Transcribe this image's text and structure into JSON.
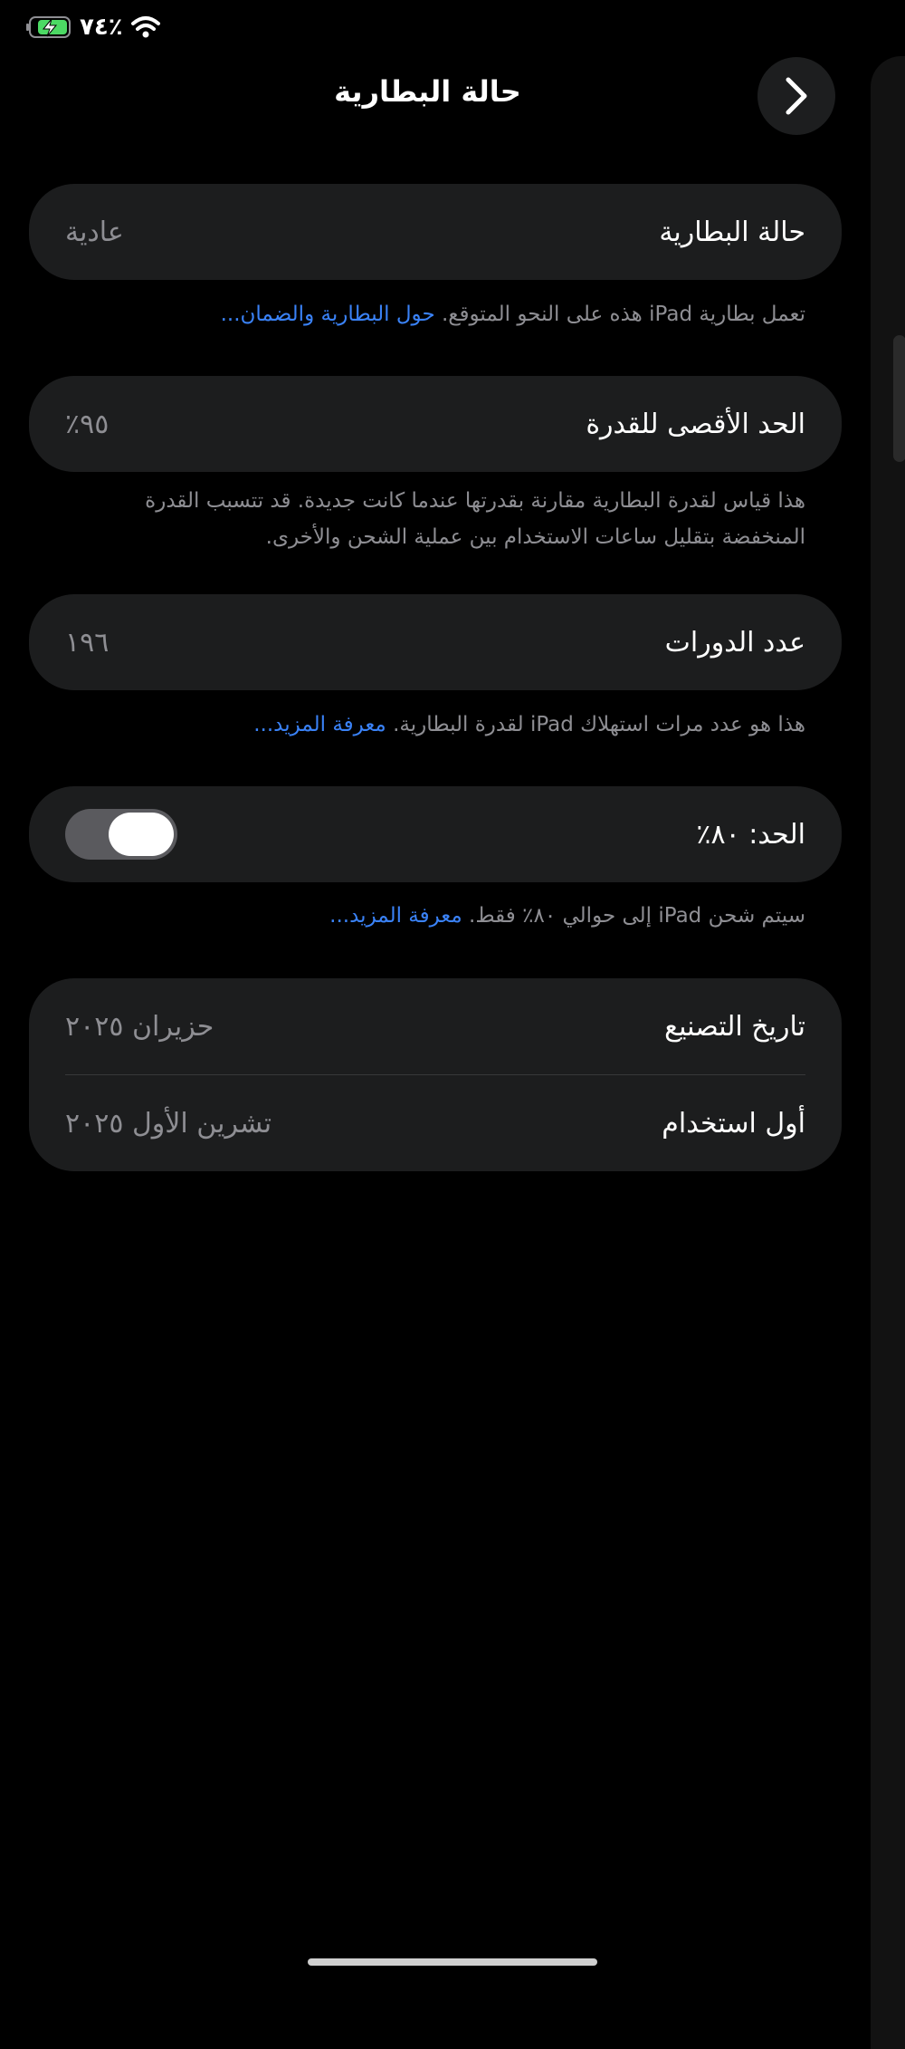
{
  "status": {
    "battery_percent": "٧٤٪",
    "battery_icon": "battery-charging-icon",
    "wifi_icon": "wifi-icon"
  },
  "nav": {
    "title": "حالة البطارية",
    "back_icon": "chevron-right-icon"
  },
  "battery_condition": {
    "label": "حالة البطارية",
    "value": "عادية",
    "footnote_text": "تعمل بطارية iPad هذه على النحو المتوقع. ",
    "footnote_link": "حول البطارية والضمان..."
  },
  "max_capacity": {
    "label": "الحد الأقصى للقدرة",
    "value": "٩٥٪",
    "footnote_line1": "هذا قياس لقدرة البطارية مقارنة بقدرتها عندما كانت جديدة. قد تتسبب القدرة",
    "footnote_line2": "المنخفضة بتقليل ساعات الاستخدام بين عملية الشحن والأخرى."
  },
  "cycle_count": {
    "label": "عدد الدورات",
    "value": "١٩٦",
    "footnote_text": "هذا هو عدد مرات استهلاك iPad لقدرة البطارية. ",
    "footnote_link": "معرفة المزيد..."
  },
  "limit": {
    "label": "الحد: ٨٠٪",
    "toggle_on": true,
    "footnote_text": "سيتم شحن iPad إلى حوالي ٨٠٪ فقط. ",
    "footnote_link": "معرفة المزيد..."
  },
  "dates": {
    "manufacture_label": "تاريخ التصنيع",
    "manufacture_value": "حزيران ٢٠٢٥",
    "first_use_label": "أول استخدام",
    "first_use_value": "تشرين الأول ٢٠٢٥"
  },
  "colors": {
    "background": "#000000",
    "card": "#1c1d1e",
    "link": "#3a82f7",
    "secondary_text": "#8e8e93"
  }
}
